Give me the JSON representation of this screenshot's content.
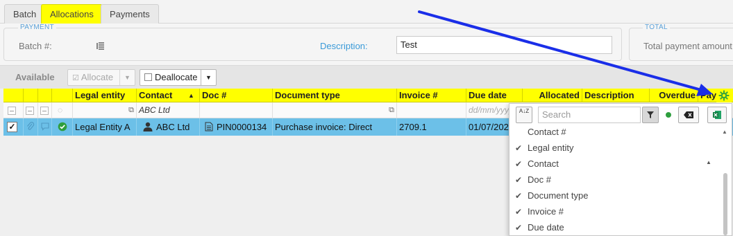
{
  "tabs": [
    "Batch",
    "Allocations",
    "Payments"
  ],
  "payment": {
    "legend": "PAYMENT",
    "batch_label": "Batch #:",
    "description_label": "Description:",
    "description_value": "Test"
  },
  "total": {
    "legend": "TOTAL",
    "label": "Total payment amount"
  },
  "toolbar": {
    "available_label": "Available",
    "allocate_label": "Allocate",
    "deallocate_label": "Deallocate"
  },
  "columns": [
    "Legal entity",
    "Contact",
    "Doc #",
    "Document type",
    "Invoice #",
    "Due date",
    "Allocated",
    "Description",
    "Overdue",
    "Paym"
  ],
  "filter": {
    "contact": "ABC Ltd",
    "due_date_placeholder": "dd/mm/yyyy"
  },
  "row": {
    "legal_entity": "Legal Entity A",
    "contact": "ABC Ltd",
    "doc": "PIN0000134",
    "document_type": "Purchase invoice: Direct",
    "invoice": "2709.1",
    "due_date": "01/07/202"
  },
  "chooser": {
    "search_placeholder": "Search",
    "sort_icon_text": "A↓Z",
    "items": [
      {
        "label": "Contact #",
        "checked": false
      },
      {
        "label": "Legal entity",
        "checked": true
      },
      {
        "label": "Contact",
        "checked": true
      },
      {
        "label": "Doc #",
        "checked": true
      },
      {
        "label": "Document type",
        "checked": true
      },
      {
        "label": "Invoice #",
        "checked": true
      },
      {
        "label": "Due date",
        "checked": true
      }
    ]
  },
  "colors": {
    "highlight": "#ffff00",
    "selected_row": "#6cc0e8",
    "accent_blue": "#1a2ee8",
    "gear_green": "#3aa63a"
  }
}
